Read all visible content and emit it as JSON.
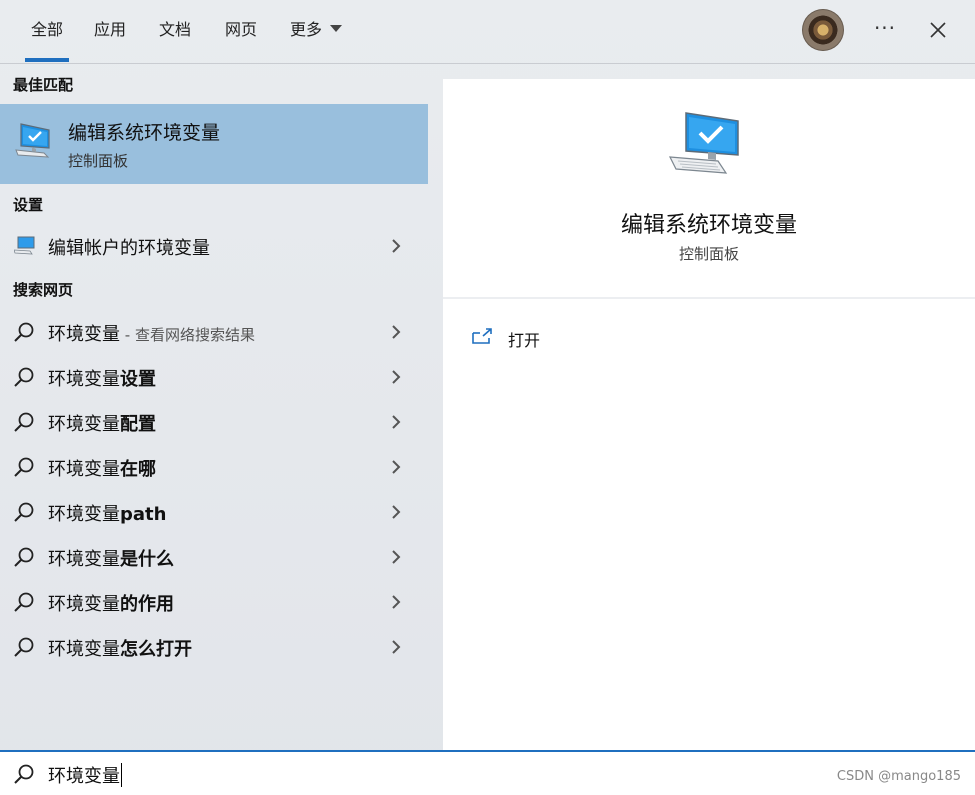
{
  "tabs": [
    {
      "label": "全部",
      "active": true
    },
    {
      "label": "应用"
    },
    {
      "label": "文档"
    },
    {
      "label": "网页"
    },
    {
      "label": "更多"
    }
  ],
  "sections": {
    "best_match": "最佳匹配",
    "settings": "设置",
    "web": "搜索网页"
  },
  "best_match": {
    "title": "编辑系统环境变量",
    "subtitle": "控制面板"
  },
  "settings_item": {
    "label": "编辑帐户的环境变量"
  },
  "web_results": [
    {
      "base": "环境变量",
      "bold": "",
      "hint": " - 查看网络搜索结果"
    },
    {
      "base": "环境变量",
      "bold": "设置",
      "hint": ""
    },
    {
      "base": "环境变量",
      "bold": "配置",
      "hint": ""
    },
    {
      "base": "环境变量",
      "bold": "在哪",
      "hint": ""
    },
    {
      "base": "环境变量",
      "bold": "path",
      "hint": ""
    },
    {
      "base": "环境变量",
      "bold": "是什么",
      "hint": ""
    },
    {
      "base": "环境变量",
      "bold": "的作用",
      "hint": ""
    },
    {
      "base": "环境变量",
      "bold": "怎么打开",
      "hint": ""
    }
  ],
  "preview": {
    "title": "编辑系统环境变量",
    "subtitle": "控制面板",
    "action_open": "打开"
  },
  "search": {
    "query": "环境变量"
  },
  "watermark": "CSDN @mango185",
  "colors": {
    "accent": "#1f6fbf",
    "selected_bg": "#99bfdd"
  }
}
